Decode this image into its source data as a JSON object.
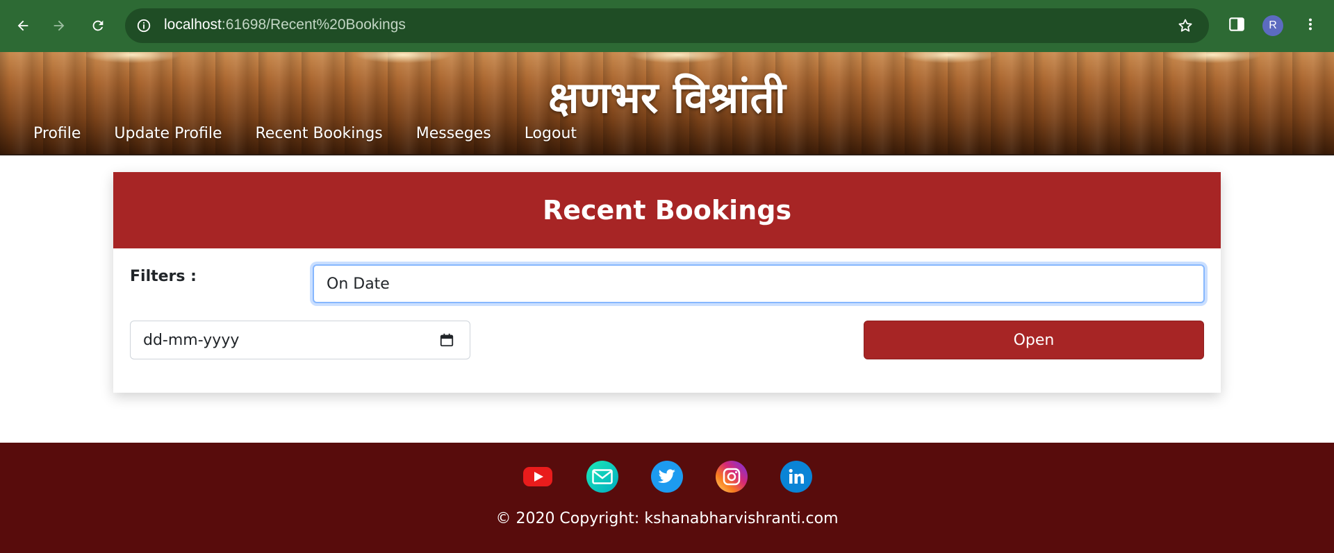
{
  "browser": {
    "url_host": "localhost",
    "url_rest": ":61698/Recent%20Bookings",
    "avatar_letter": "R",
    "icons": [
      "back-icon",
      "forward-icon",
      "reload-icon",
      "info-icon",
      "star-icon",
      "side-panel-icon",
      "more-icon"
    ]
  },
  "header": {
    "brand": "क्षणभर विश्रांती",
    "nav": [
      {
        "label": "Profile"
      },
      {
        "label": "Update Profile"
      },
      {
        "label": "Recent Bookings"
      },
      {
        "label": "Messeges"
      },
      {
        "label": "Logout"
      }
    ]
  },
  "main": {
    "title": "Recent Bookings",
    "filters_label": "Filters :",
    "filter_selected": "On Date",
    "date_placeholder": "dd-mm-yyyy",
    "open_button": "Open"
  },
  "footer": {
    "socials": [
      "youtube-icon",
      "mail-icon",
      "twitter-icon",
      "instagram-icon",
      "linkedin-icon"
    ],
    "copyright": "© 2020 Copyright: kshanabharvishranti.com"
  },
  "colors": {
    "chrome": "#2d6a34",
    "accent": "#a72525",
    "footer": "#580c0c"
  }
}
